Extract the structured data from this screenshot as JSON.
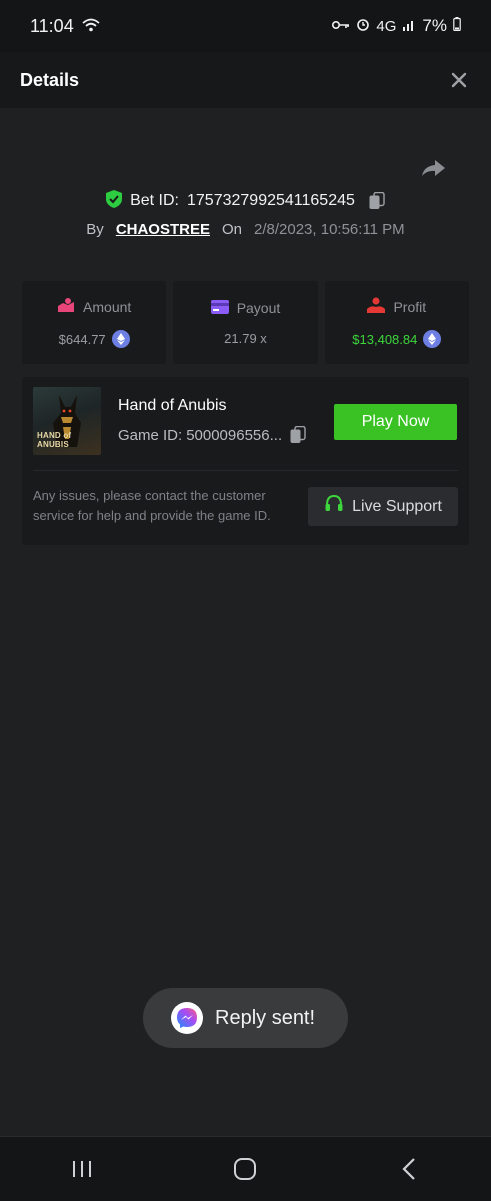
{
  "status_bar": {
    "time": "11:04",
    "network": "4G",
    "battery": "7%"
  },
  "header": {
    "title": "Details"
  },
  "bet": {
    "id_label": "Bet ID:",
    "id_value": "1757327992541165245",
    "by_label": "By",
    "user": "CHAOSTREE",
    "on_label": "On",
    "date": "2/8/2023, 10:56:11 PM"
  },
  "stats": {
    "amount_label": "Amount",
    "amount_value": "$644.77",
    "payout_label": "Payout",
    "payout_value": "21.79 x",
    "profit_label": "Profit",
    "profit_value": "$13,408.84"
  },
  "game": {
    "name": "Hand of Anubis",
    "thumb_line1": "HAND of",
    "thumb_line2": "ANUBIS",
    "game_id_label": "Game ID:",
    "game_id_value": "5000096556...",
    "play_label": "Play Now",
    "notice": "Any issues, please contact the customer service for help and provide the game ID.",
    "support_label": "Live Support"
  },
  "toast": {
    "text": "Reply sent!"
  },
  "colors": {
    "accent_green": "#3ac225",
    "profit_green": "#3dd63d",
    "eth_blue": "#6d7fe2",
    "amount_pink": "#e8457a",
    "payout_purple": "#8b5cf6",
    "profit_red": "#e53935"
  },
  "icons": [
    "wifi-icon",
    "key-icon",
    "alarm-icon",
    "signal-icon",
    "battery-icon",
    "close-icon",
    "share-icon",
    "shield-check-icon",
    "copy-icon",
    "amount-icon",
    "payout-card-icon",
    "profit-icon",
    "eth-icon",
    "headset-icon",
    "messenger-icon",
    "recents-icon",
    "home-icon",
    "back-icon"
  ]
}
